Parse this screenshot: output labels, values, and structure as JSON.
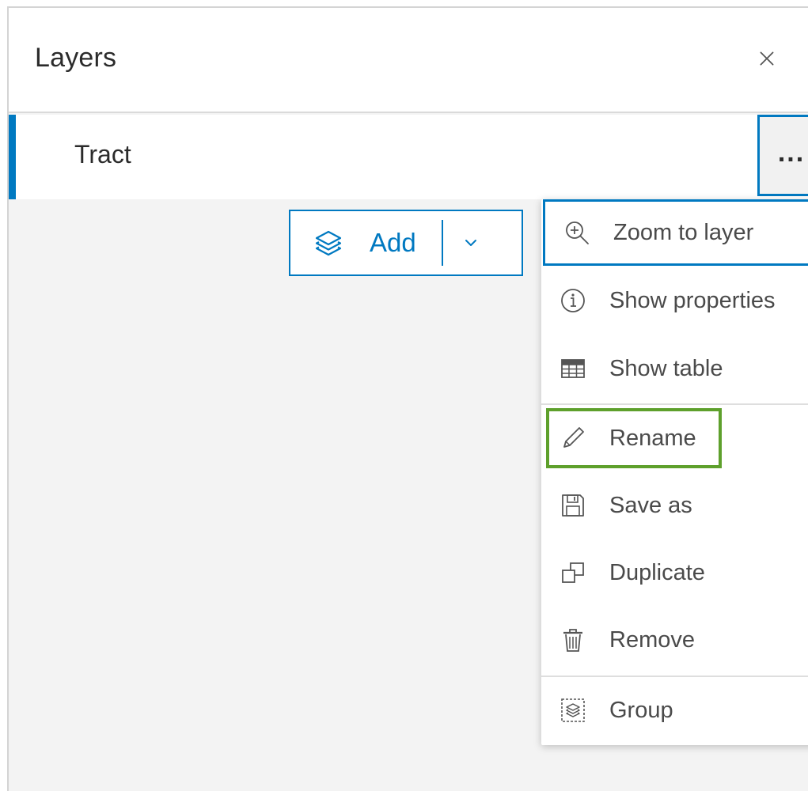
{
  "panel": {
    "title": "Layers"
  },
  "layer": {
    "name": "Tract",
    "more_label": "..."
  },
  "add_button": {
    "label": "Add"
  },
  "menu": {
    "items": [
      {
        "label": "Zoom to layer",
        "icon": "zoom-in-icon"
      },
      {
        "label": "Show properties",
        "icon": "information-icon"
      },
      {
        "label": "Show table",
        "icon": "table-icon"
      },
      {
        "label": "Rename",
        "icon": "pencil-icon"
      },
      {
        "label": "Save as",
        "icon": "save-icon"
      },
      {
        "label": "Duplicate",
        "icon": "duplicate-icon"
      },
      {
        "label": "Remove",
        "icon": "trash-icon"
      },
      {
        "label": "Group",
        "icon": "group-layers-icon"
      }
    ]
  },
  "colors": {
    "accent": "#0079c1",
    "highlight": "#5ea02c",
    "panel_bg": "#f3f3f3",
    "text": "#2b2b2b"
  }
}
